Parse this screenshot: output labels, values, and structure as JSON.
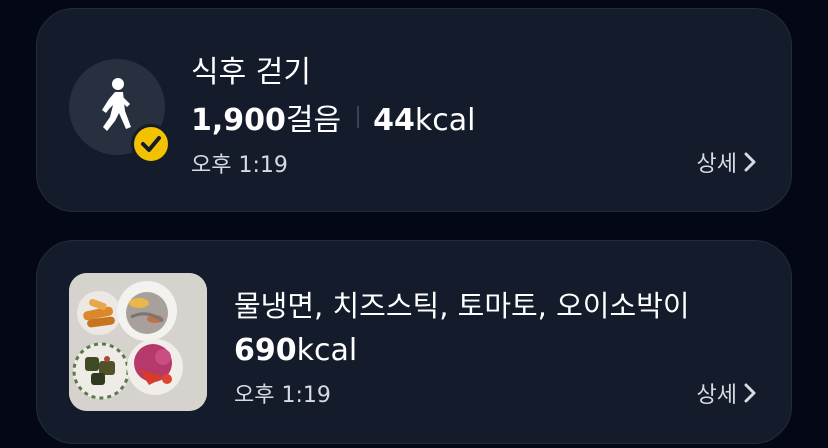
{
  "walk_card": {
    "title": "식후 걷기",
    "steps_value": "1,900",
    "steps_unit": "걸음",
    "kcal_value": "44",
    "kcal_unit": "kcal",
    "time": "오후 1:19",
    "detail_label": "상세",
    "icon": "walking-person-icon",
    "badge_icon": "check-icon"
  },
  "meal_card": {
    "title": "물냉면, 치즈스틱, 토마토, 오이소박이",
    "kcal_value": "690",
    "kcal_unit": "kcal",
    "time": "오후 1:19",
    "detail_label": "상세",
    "photo": "meal-photo"
  },
  "colors": {
    "background": "#030716",
    "card": "#141b2b",
    "badge": "#f2c200",
    "text": "#ffffff",
    "subtext": "#d8dbe2"
  }
}
